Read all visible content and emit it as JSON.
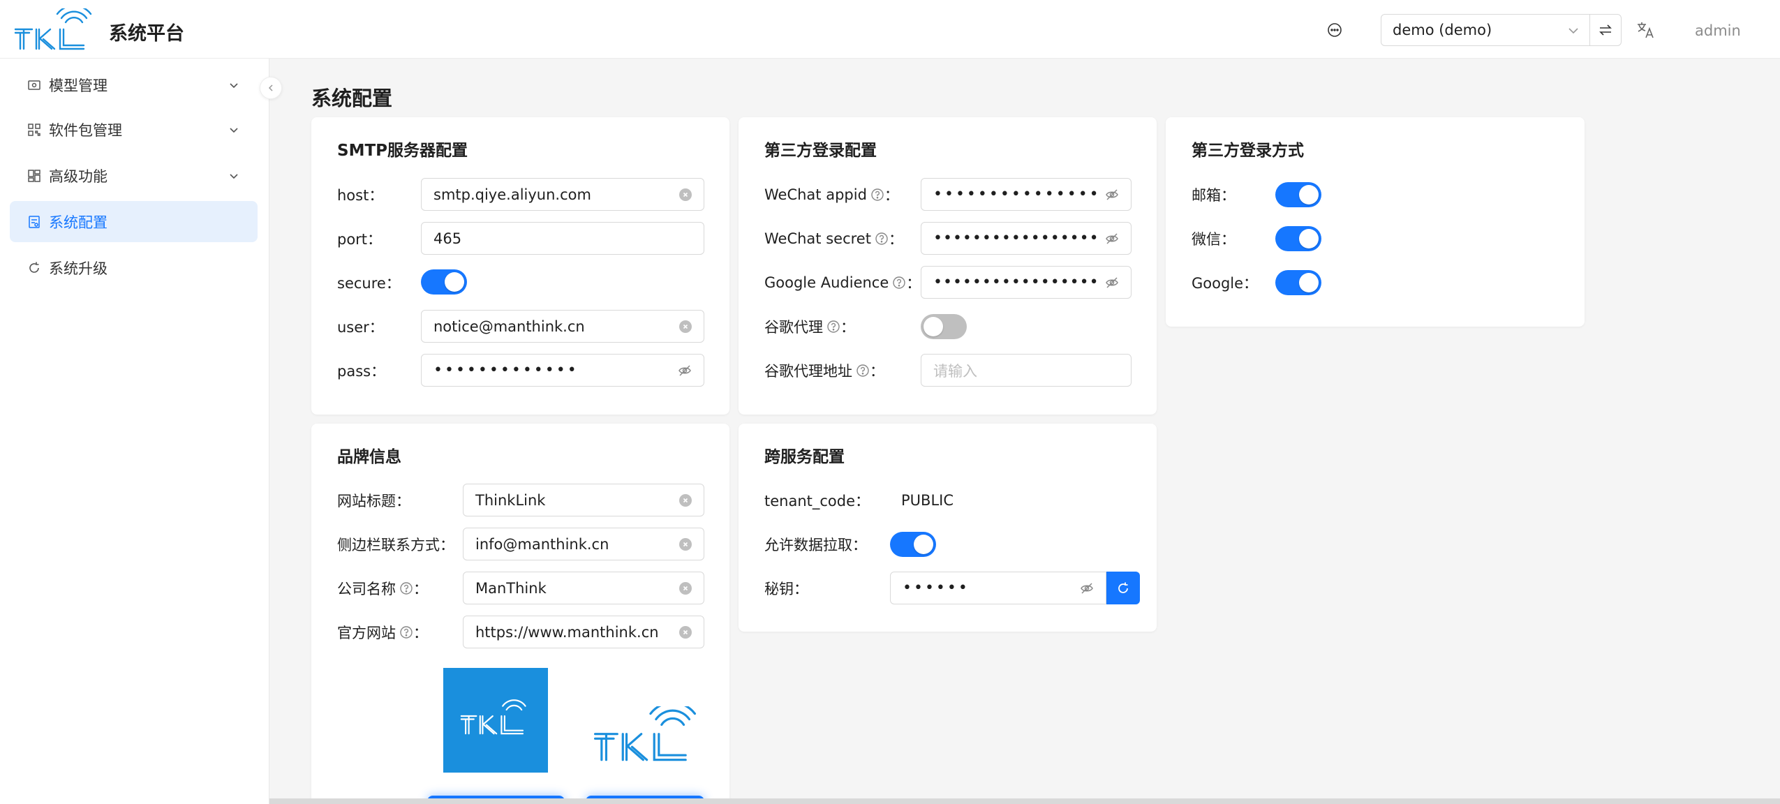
{
  "header": {
    "app_title": "系统平台",
    "logo_text": "TKL",
    "tenant_value": "demo (demo)",
    "user_name": "admin",
    "icons": [
      "message-icon",
      "swap-icon",
      "translate-icon",
      "chevron-down-icon"
    ]
  },
  "sidebar": {
    "items": [
      {
        "label": "模型管理",
        "icon": "model-icon",
        "has_arrow": true,
        "active": false
      },
      {
        "label": "软件包管理",
        "icon": "qrcode-icon",
        "has_arrow": true,
        "active": false
      },
      {
        "label": "高级功能",
        "icon": "dashboard-icon",
        "has_arrow": true,
        "active": false
      },
      {
        "label": "系统配置",
        "icon": "config-icon",
        "has_arrow": false,
        "active": true
      },
      {
        "label": "系统升级",
        "icon": "reload-icon",
        "has_arrow": false,
        "active": false
      }
    ]
  },
  "page_title": "系统配置",
  "smtp": {
    "title": "SMTP服务器配置",
    "host_label": "host：",
    "host_value": "smtp.qiye.aliyun.com",
    "port_label": "port：",
    "port_value": "465",
    "secure_label": "secure：",
    "secure_on": true,
    "user_label": "user：",
    "user_value": "notice@manthink.cn",
    "pass_label": "pass：",
    "pass_value": "•••••••••••••"
  },
  "third_party_config": {
    "title": "第三方登录配置",
    "wechat_appid_label": "WeChat appid",
    "wechat_appid_value": "•••••••••••••••••",
    "wechat_secret_label": "WeChat secret",
    "wechat_secret_value": "••••••••••••••••••••••••",
    "google_audience_label": "Google Audience",
    "google_audience_value": "••••••••••••••••••••••••",
    "proxy_label": "谷歌代理",
    "proxy_on": false,
    "proxy_addr_label": "谷歌代理地址",
    "proxy_addr_placeholder": "请输入",
    "colon": "："
  },
  "third_party_methods": {
    "title": "第三方登录方式",
    "email_label": "邮箱：",
    "email_on": true,
    "wechat_label": "微信：",
    "wechat_on": true,
    "google_label": "Google：",
    "google_on": true
  },
  "brand": {
    "title": "品牌信息",
    "site_title_label": "网站标题：",
    "site_title_value": "ThinkLink",
    "sidebar_contact_label": "侧边栏联系方式：",
    "sidebar_contact_value": "info@manthink.cn",
    "company_label": "公司名称",
    "company_value": "ManThink",
    "website_label": "官方网站",
    "website_value": "https://www.manthink.cn",
    "colon": "："
  },
  "cross_service": {
    "title": "跨服务配置",
    "tenant_code_label": "tenant_code：",
    "tenant_code_value": "PUBLIC",
    "allow_pull_label": "允许数据拉取：",
    "allow_pull_on": true,
    "secret_label": "秘钥：",
    "secret_value": "••••••"
  },
  "colors": {
    "primary": "#1677ff",
    "logo_blue": "#1a8fdd",
    "active_bg": "#e6f0fd"
  }
}
